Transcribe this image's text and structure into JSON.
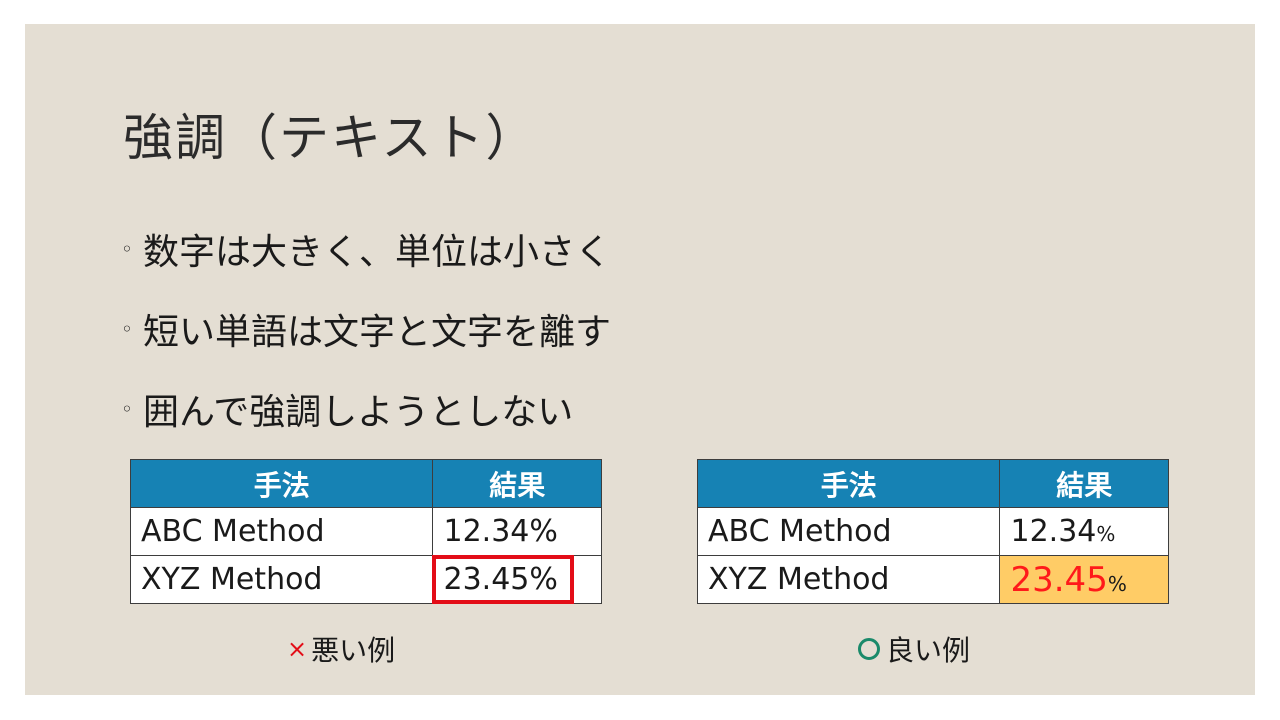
{
  "slide": {
    "title": "強調（テキスト）",
    "bullets": [
      "数字は大きく、単位は小さく",
      "短い単語は文字と文字を離す",
      "囲んで強調しようとしない"
    ],
    "bullet_marker": "◦"
  },
  "bad_example": {
    "headers": [
      "手法",
      "結果"
    ],
    "rows": [
      {
        "method": "ABC Method",
        "result": "12.34%"
      },
      {
        "method": "XYZ Method",
        "result": "23.45%"
      }
    ],
    "caption_mark": "×",
    "caption": "悪い例"
  },
  "good_example": {
    "headers": [
      "手法",
      "結果"
    ],
    "rows": [
      {
        "method": "ABC Method",
        "number": "12.34",
        "unit": "%"
      },
      {
        "method": "XYZ Method",
        "number": "23.45",
        "unit": "%"
      }
    ],
    "caption": "良い例"
  },
  "colors": {
    "background": "#e4ded3",
    "header_fill": "#1682b4",
    "outline_red": "#e30d17",
    "highlight_fill": "#ffcc66",
    "emphasis_number": "#ff1a1a",
    "good_mark": "#1a8a6a"
  }
}
